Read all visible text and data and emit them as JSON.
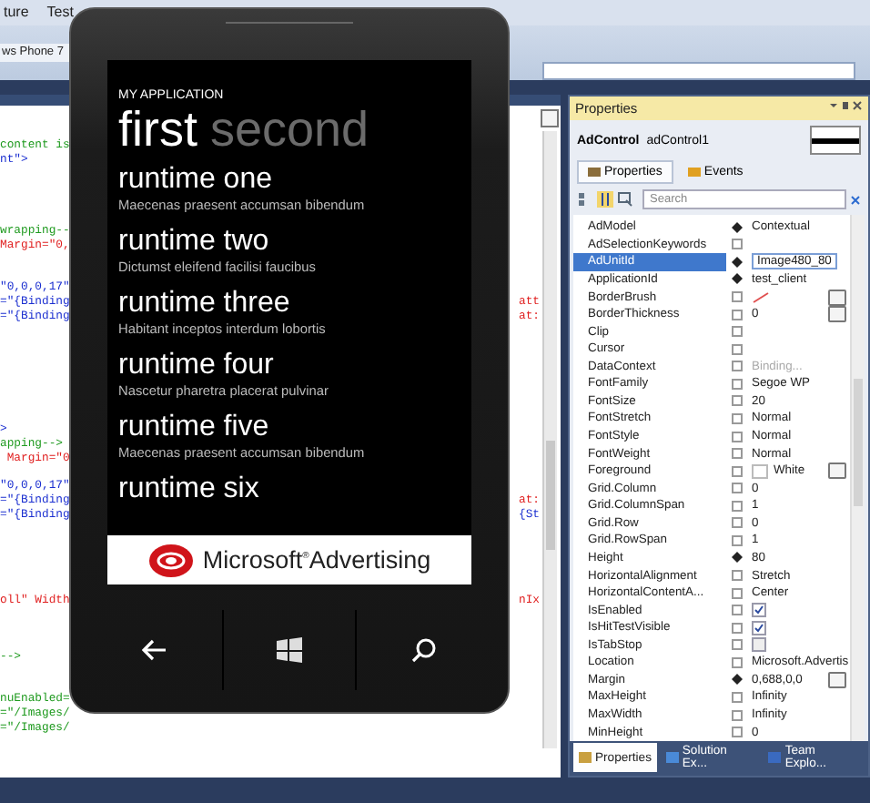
{
  "menu_bar": {
    "items": [
      "ture",
      "Test"
    ]
  },
  "document_tab": {
    "title": "ws Phone 7"
  },
  "editor": {
    "blocks": [
      {
        "lines": [
          {
            "left": [
              {
                "text": "content is",
                "kind": "comment"
              }
            ]
          },
          {
            "left": [
              {
                "text": "nt\">",
                "kind": "value"
              }
            ]
          }
        ]
      },
      {
        "lines": [
          {
            "left": [
              {
                "text": "wrapping--",
                "kind": "comment"
              }
            ]
          },
          {
            "left": [
              {
                "text": "Margin=\"0,",
                "kind": "attr"
              }
            ]
          }
        ]
      },
      {
        "lines": [
          {
            "left": [
              {
                "text": "\"0,0,0,17\"",
                "kind": "value"
              }
            ]
          },
          {
            "left": [
              {
                "text": "=\"{Binding",
                "kind": "value"
              }
            ],
            "right": {
              "text": "att",
              "kind": "attr"
            }
          },
          {
            "left": [
              {
                "text": "=\"{Binding",
                "kind": "value"
              }
            ],
            "right": {
              "text": "at:",
              "kind": "attr"
            }
          }
        ]
      },
      {
        "lines": [
          {
            "left": [
              {
                "text": ">",
                "kind": "value"
              }
            ]
          },
          {
            "left": [
              {
                "text": "apping-->",
                "kind": "comment"
              }
            ]
          },
          {
            "left": [
              {
                "text": " Margin=\"0",
                "kind": "attr"
              }
            ]
          }
        ]
      },
      {
        "lines": [
          {
            "left": [
              {
                "text": "\"0,0,0,17\"",
                "kind": "value"
              }
            ]
          },
          {
            "left": [
              {
                "text": "=\"{Binding",
                "kind": "value"
              }
            ],
            "right": {
              "text": "at:",
              "kind": "attr"
            }
          },
          {
            "left": [
              {
                "text": "=\"{Binding",
                "kind": "value"
              }
            ],
            "right": {
              "text": "{St",
              "kind": "value"
            }
          }
        ]
      },
      {
        "lines": [
          {
            "left": [
              {
                "text": "oll\" Width",
                "kind": "attr"
              }
            ],
            "right": {
              "text": "nIx",
              "kind": "attr"
            }
          }
        ]
      },
      {
        "lines": [
          {
            "left": [
              {
                "text": "-->",
                "kind": "comment"
              }
            ]
          }
        ]
      },
      {
        "lines": [
          {
            "left": [
              {
                "text": "nuEnabled=",
                "kind": "comment"
              }
            ]
          },
          {
            "left": [
              {
                "text": "=\"/Images/",
                "kind": "comment"
              }
            ]
          },
          {
            "left": [
              {
                "text": "=\"/Images/",
                "kind": "comment"
              }
            ]
          }
        ]
      }
    ]
  },
  "phone": {
    "app_title": "MY APPLICATION",
    "pivots": [
      {
        "label": "first",
        "selected": true
      },
      {
        "label": "second",
        "selected": false
      }
    ],
    "items": [
      {
        "title": "runtime one",
        "subtitle": "Maecenas praesent accumsan bibendum"
      },
      {
        "title": "runtime two",
        "subtitle": "Dictumst eleifend facilisi faucibus"
      },
      {
        "title": "runtime three",
        "subtitle": "Habitant inceptos interdum lobortis"
      },
      {
        "title": "runtime four",
        "subtitle": "Nascetur pharetra placerat pulvinar"
      },
      {
        "title": "runtime five",
        "subtitle": "Maecenas praesent accumsan bibendum"
      },
      {
        "title": "runtime six"
      }
    ],
    "ad": {
      "brand": "Microsoft",
      "brand_mark": "®",
      "product": "Advertising"
    }
  },
  "properties": {
    "title": "Properties",
    "control_type": "AdControl",
    "control_name": "adControl1",
    "tabs": [
      {
        "label": "Properties",
        "selected": true
      },
      {
        "label": "Events",
        "selected": false
      }
    ],
    "search": {
      "placeholder": "Search"
    },
    "rows": [
      {
        "name": "AdModel",
        "set": true,
        "kind": "text",
        "value": "Contextual",
        "selected": false
      },
      {
        "name": "AdSelectionKeywords",
        "set": false,
        "kind": "text",
        "selected": false
      },
      {
        "name": "AdUnitId",
        "set": true,
        "kind": "text",
        "value": "Image480_80",
        "selected": true
      },
      {
        "name": "ApplicationId",
        "set": true,
        "kind": "text",
        "value": "test_client",
        "selected": false
      },
      {
        "name": "BorderBrush",
        "set": false,
        "kind": "brush",
        "selected": false
      },
      {
        "name": "BorderThickness",
        "set": false,
        "kind": "dropdown",
        "value": "0",
        "selected": false
      },
      {
        "name": "Clip",
        "set": false,
        "kind": "text",
        "selected": false
      },
      {
        "name": "Cursor",
        "set": false,
        "kind": "text",
        "selected": false
      },
      {
        "name": "DataContext",
        "set": false,
        "kind": "binding",
        "value": "Binding...",
        "selected": false
      },
      {
        "name": "FontFamily",
        "set": false,
        "kind": "text",
        "value": "Segoe WP",
        "selected": false
      },
      {
        "name": "FontSize",
        "set": false,
        "kind": "text",
        "value": "20",
        "selected": false
      },
      {
        "name": "FontStretch",
        "set": false,
        "kind": "text",
        "value": "Normal",
        "selected": false
      },
      {
        "name": "FontStyle",
        "set": false,
        "kind": "text",
        "value": "Normal",
        "selected": false
      },
      {
        "name": "FontWeight",
        "set": false,
        "kind": "text",
        "value": "Normal",
        "selected": false
      },
      {
        "name": "Foreground",
        "set": false,
        "kind": "color",
        "value": "White",
        "color": "#ffffff",
        "selected": false
      },
      {
        "name": "Grid.Column",
        "set": false,
        "kind": "text",
        "value": "0",
        "selected": false
      },
      {
        "name": "Grid.ColumnSpan",
        "set": false,
        "kind": "text",
        "value": "1",
        "selected": false
      },
      {
        "name": "Grid.Row",
        "set": false,
        "kind": "text",
        "value": "0",
        "selected": false
      },
      {
        "name": "Grid.RowSpan",
        "set": false,
        "kind": "text",
        "value": "1",
        "selected": false
      },
      {
        "name": "Height",
        "set": true,
        "kind": "text",
        "value": "80",
        "selected": false
      },
      {
        "name": "HorizontalAlignment",
        "set": false,
        "kind": "text",
        "value": "Stretch",
        "selected": false
      },
      {
        "name": "HorizontalContentA...",
        "set": false,
        "kind": "text",
        "value": "Center",
        "selected": false
      },
      {
        "name": "IsEnabled",
        "set": false,
        "kind": "checkbox",
        "checked": true,
        "selected": false
      },
      {
        "name": "IsHitTestVisible",
        "set": false,
        "kind": "checkbox",
        "checked": true,
        "selected": false
      },
      {
        "name": "IsTabStop",
        "set": false,
        "kind": "checkbox",
        "checked": false,
        "selected": false
      },
      {
        "name": "Location",
        "set": false,
        "kind": "text",
        "value": "Microsoft.Advertis",
        "selected": false
      },
      {
        "name": "Margin",
        "set": true,
        "kind": "dropdown",
        "value": "0,688,0,0",
        "selected": false
      },
      {
        "name": "MaxHeight",
        "set": false,
        "kind": "text",
        "value": "Infinity",
        "selected": false
      },
      {
        "name": "MaxWidth",
        "set": false,
        "kind": "text",
        "value": "Infinity",
        "selected": false
      },
      {
        "name": "MinHeight",
        "set": false,
        "kind": "text",
        "value": "0",
        "selected": false
      }
    ],
    "bottom_tabs": [
      {
        "label": "Properties",
        "selected": true
      },
      {
        "label": "Solution Ex...",
        "selected": false
      },
      {
        "label": "Team Explo...",
        "selected": false
      }
    ]
  }
}
